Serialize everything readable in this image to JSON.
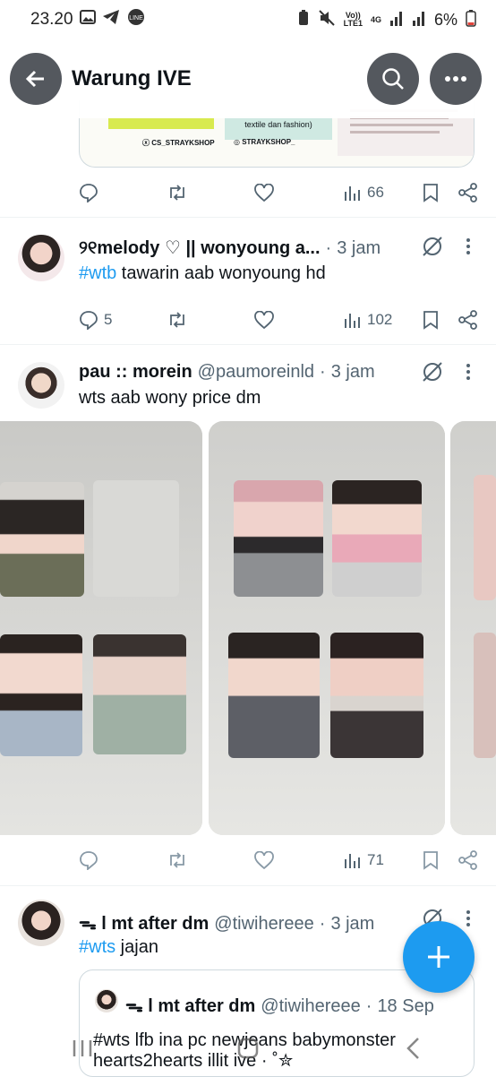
{
  "status_bar": {
    "time": "23.20",
    "battery": "6%",
    "network": "4G",
    "lte_label": "LTE1",
    "volte": "Vo))"
  },
  "header": {
    "title": "Warung IVE"
  },
  "prev_tweet": {
    "views": "66",
    "card_left_text": "textile dan fashion)",
    "handle1": "CS_STRAYKSHOP",
    "handle2": "STRAYKSHOP_"
  },
  "tweets": [
    {
      "name": "୨୧melody ♡ || wonyoung a...",
      "handle": "",
      "time": "3 jam",
      "hashtag": "#wtb",
      "text": " tawarin aab wonyoung hd",
      "replies": "5",
      "views": "102"
    },
    {
      "name": "pau :: morein",
      "handle": "@paumoreinld",
      "time": "3 jam",
      "text": "wts aab wony price dm",
      "views": "71"
    },
    {
      "name": "ᯓ l mt after dm",
      "handle": "@tiwihereee",
      "time": "3 jam",
      "hashtag": "#wts",
      "text": " jajan"
    }
  ],
  "quote": {
    "name": "ᯓ l mt after dm",
    "handle": "@tiwihereee",
    "time": "18 Sep",
    "text": "#wts lfb ina pc newjeans babymonster hearts2hearts illit ive · ˚✮"
  },
  "dot": "·",
  "colors": {
    "accent": "#1d9bf0",
    "header_button": "#54585e",
    "muted": "#536471"
  }
}
